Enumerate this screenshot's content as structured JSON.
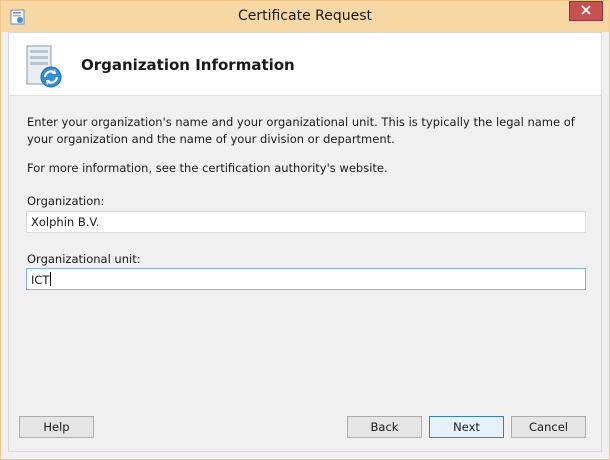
{
  "window": {
    "title": "Certificate Request"
  },
  "header": {
    "title": "Organization Information",
    "icon": "server-sync-icon"
  },
  "body": {
    "description": "Enter your organization's name and your organizational unit. This is typically the legal name of your organization and the name of your division or department.",
    "more_info": "For more information, see the certification authority's website."
  },
  "form": {
    "organization_label": "Organization:",
    "organization_value": "Xolphin B.V.",
    "unit_label": "Organizational unit:",
    "unit_value": "ICT"
  },
  "buttons": {
    "help": "Help",
    "back": "Back",
    "next": "Next",
    "cancel": "Cancel"
  },
  "colors": {
    "titlebar": "#f7d7a3",
    "close_button": "#c75050",
    "focus_border": "#7eb4ea",
    "default_button_border": "#3c7fb1"
  }
}
